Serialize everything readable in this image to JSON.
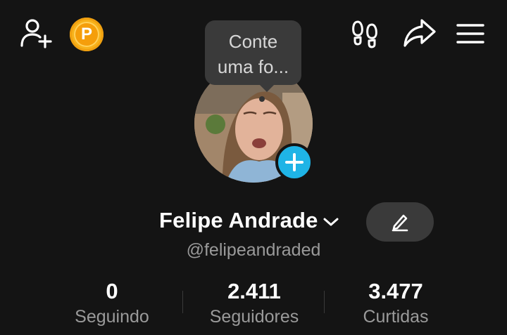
{
  "topbar": {
    "add_friend_icon": "add-person-icon",
    "coin_label": "P",
    "coin_color": "#f59e0b",
    "footprints_icon": "footprints-icon",
    "share_icon": "share-arrow-icon",
    "menu_icon": "hamburger-menu-icon"
  },
  "tooltip": {
    "line1": "Conte",
    "line2": "uma fo..."
  },
  "profile": {
    "name": "Felipe Andrade",
    "handle": "@felipeandraded",
    "avatar_add_color": "#1fb4e6",
    "edit_icon": "pencil-icon"
  },
  "stats": [
    {
      "value": "0",
      "label": "Seguindo"
    },
    {
      "value": "2.411",
      "label": "Seguidores"
    },
    {
      "value": "3.477",
      "label": "Curtidas"
    }
  ]
}
